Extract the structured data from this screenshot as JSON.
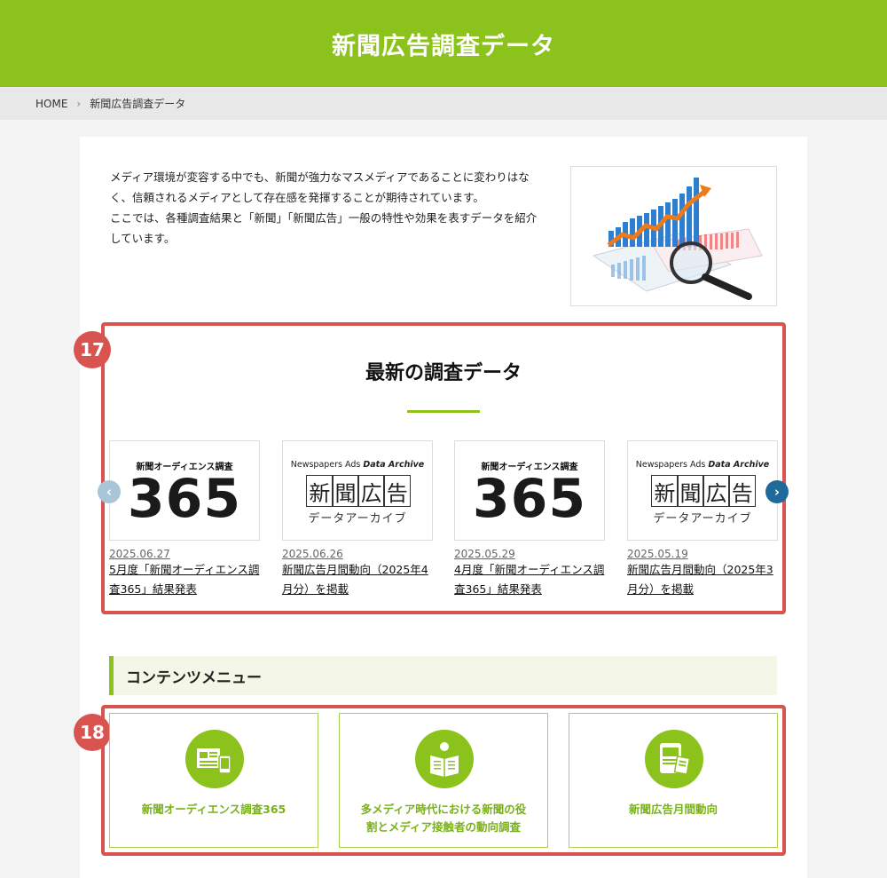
{
  "header": {
    "title": "新聞広告調査データ"
  },
  "breadcrumb": {
    "home": "HOME",
    "separator": "›",
    "current": "新聞広告調査データ"
  },
  "intro": {
    "paragraph1": "メディア環境が変容する中でも、新聞が強力なマスメディアであることに変わりはなく、信頼されるメディアとして存在感を発揮することが期待されています。",
    "paragraph2": "ここでは、各種調査結果と「新聞」「新聞広告」一般の特性や効果を表すデータを紹介しています。"
  },
  "annotations": {
    "badge17": "17",
    "badge18": "18"
  },
  "latest": {
    "title": "最新の調査データ",
    "prev": "‹",
    "next": "›",
    "thumb365": {
      "head": "新聞オーディエンス調査",
      "number": "365"
    },
    "thumbArchive": {
      "top_plain": "Newspapers Ads ",
      "top_italic": "Data Archive",
      "chars": [
        "新",
        "聞",
        "広",
        "告"
      ],
      "sub": "データアーカイブ"
    },
    "items": [
      {
        "date": "2025.06.27",
        "title": "5月度「新聞オーディエンス調査365」結果発表"
      },
      {
        "date": "2025.06.26",
        "title": "新聞広告月間動向（2025年4月分）を掲載"
      },
      {
        "date": "2025.05.29",
        "title": "4月度「新聞オーディエンス調査365」結果発表"
      },
      {
        "date": "2025.05.19",
        "title": "新聞広告月間動向（2025年3月分）を掲載"
      }
    ]
  },
  "contents": {
    "title": "コンテンツメニュー",
    "items": [
      {
        "label": "新聞オーディエンス調査365",
        "icon": "newspaper-tablet-icon"
      },
      {
        "label": "多メディア時代における新聞の役割とメディア接触者の動向調査",
        "icon": "person-reading-icon"
      },
      {
        "label": "新聞広告月間動向",
        "icon": "tablet-document-icon"
      }
    ]
  },
  "colors": {
    "brand": "#8cc21c",
    "annotation": "#d9534f",
    "arrow": "#1e6a9a"
  }
}
